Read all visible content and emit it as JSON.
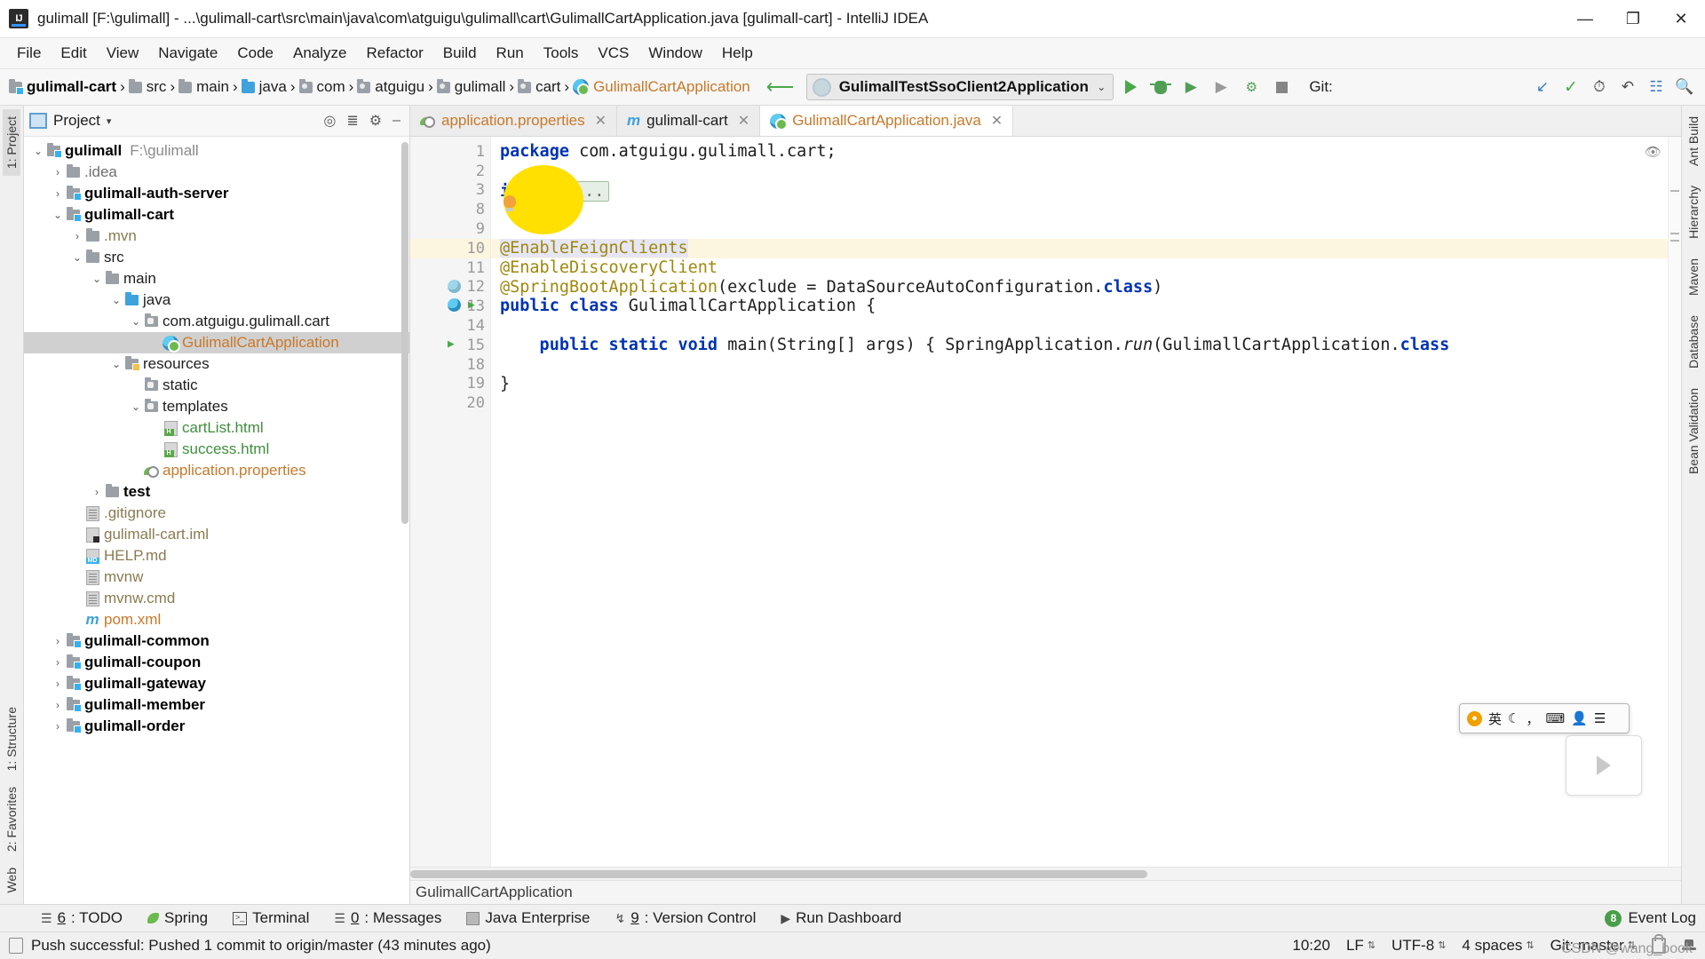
{
  "window": {
    "title": "gulimall [F:\\gulimall] - ...\\gulimall-cart\\src\\main\\java\\com\\atguigu\\gulimall\\cart\\GulimallCartApplication.java [gulimall-cart] - IntelliJ IDEA",
    "minimize": "—",
    "maximize": "❐",
    "close": "✕",
    "logo_text": "IJ"
  },
  "menubar": {
    "items": [
      "File",
      "Edit",
      "View",
      "Navigate",
      "Code",
      "Analyze",
      "Refactor",
      "Build",
      "Run",
      "Tools",
      "VCS",
      "Window",
      "Help"
    ]
  },
  "navbar": {
    "breadcrumbs": [
      {
        "label": "gulimall-cart",
        "kind": "module"
      },
      {
        "label": "src",
        "kind": "folder"
      },
      {
        "label": "main",
        "kind": "folder"
      },
      {
        "label": "java",
        "kind": "source"
      },
      {
        "label": "com",
        "kind": "package"
      },
      {
        "label": "atguigu",
        "kind": "package"
      },
      {
        "label": "gulimall",
        "kind": "package"
      },
      {
        "label": "cart",
        "kind": "package"
      },
      {
        "label": "GulimallCartApplication",
        "kind": "class"
      }
    ],
    "separator": "›",
    "run_config": {
      "name": "GulimallTestSsoClient2Application",
      "caret": "⌄"
    },
    "buttons": [
      "run-button",
      "debug-button",
      "run-with-coverage-button",
      "profile-button",
      "attach-button",
      "stop-button"
    ],
    "git_label": "Git:",
    "right_icons": [
      "update-project-icon",
      "check-icon",
      "history-icon",
      "rollback-icon",
      "open-settings-icon",
      "search-icon"
    ]
  },
  "left_rail": {
    "top": [
      "1: Project"
    ],
    "bottom": [
      "1: Structure",
      "2: Favorites",
      "Web"
    ]
  },
  "right_rail": {
    "items": [
      "Ant Build",
      "Hierarchy",
      "Maven",
      "Database",
      "Bean Validation"
    ]
  },
  "project_panel": {
    "title": "Project",
    "caret": "▾",
    "header_icons": [
      "locate-icon",
      "collapse-all-icon",
      "settings-icon",
      "hide-icon"
    ],
    "tree": [
      {
        "depth": 0,
        "arrow": "⌄",
        "icon": "module-folder",
        "label": "gulimall",
        "style": "bold",
        "suffix": "F:\\gulimall"
      },
      {
        "depth": 1,
        "arrow": "›",
        "icon": "folder",
        "label": ".idea",
        "style": "gray"
      },
      {
        "depth": 1,
        "arrow": "›",
        "icon": "module-folder",
        "label": "gulimall-auth-server",
        "style": "bold"
      },
      {
        "depth": 1,
        "arrow": "⌄",
        "icon": "module-folder",
        "label": "gulimall-cart",
        "style": "bold"
      },
      {
        "depth": 2,
        "arrow": "›",
        "icon": "folder",
        "label": ".mvn",
        "style": "tan"
      },
      {
        "depth": 2,
        "arrow": "⌄",
        "icon": "folder",
        "label": "src",
        "style": "black"
      },
      {
        "depth": 3,
        "arrow": "⌄",
        "icon": "folder",
        "label": "main",
        "style": "black"
      },
      {
        "depth": 4,
        "arrow": "⌄",
        "icon": "source-folder",
        "label": "java",
        "style": "black"
      },
      {
        "depth": 5,
        "arrow": "⌄",
        "icon": "package",
        "label": "com.atguigu.gulimall.cart",
        "style": "black"
      },
      {
        "depth": 6,
        "arrow": "",
        "icon": "spring-class",
        "label": "GulimallCartApplication",
        "style": "orange",
        "selected": true
      },
      {
        "depth": 4,
        "arrow": "⌄",
        "icon": "resource-folder",
        "label": "resources",
        "style": "black"
      },
      {
        "depth": 5,
        "arrow": "",
        "icon": "package",
        "label": "static",
        "style": "black"
      },
      {
        "depth": 5,
        "arrow": "⌄",
        "icon": "package",
        "label": "templates",
        "style": "black"
      },
      {
        "depth": 6,
        "arrow": "",
        "icon": "html-file",
        "label": "cartList.html",
        "style": "green"
      },
      {
        "depth": 6,
        "arrow": "",
        "icon": "html-file",
        "label": "success.html",
        "style": "green"
      },
      {
        "depth": 5,
        "arrow": "",
        "icon": "spring-properties",
        "label": "application.properties",
        "style": "orange"
      },
      {
        "depth": 3,
        "arrow": "›",
        "icon": "folder",
        "label": "test",
        "style": "bold"
      },
      {
        "depth": 2,
        "arrow": "",
        "icon": "text-file",
        "label": ".gitignore",
        "style": "tan"
      },
      {
        "depth": 2,
        "arrow": "",
        "icon": "iml-file",
        "label": "gulimall-cart.iml",
        "style": "tan"
      },
      {
        "depth": 2,
        "arrow": "",
        "icon": "md-file",
        "label": "HELP.md",
        "style": "tan"
      },
      {
        "depth": 2,
        "arrow": "",
        "icon": "text-file",
        "label": "mvnw",
        "style": "tan"
      },
      {
        "depth": 2,
        "arrow": "",
        "icon": "text-file",
        "label": "mvnw.cmd",
        "style": "tan"
      },
      {
        "depth": 2,
        "arrow": "",
        "icon": "maven-file",
        "label": "pom.xml",
        "style": "orange"
      },
      {
        "depth": 1,
        "arrow": "›",
        "icon": "module-folder",
        "label": "gulimall-common",
        "style": "bold"
      },
      {
        "depth": 1,
        "arrow": "›",
        "icon": "module-folder",
        "label": "gulimall-coupon",
        "style": "bold"
      },
      {
        "depth": 1,
        "arrow": "›",
        "icon": "module-folder",
        "label": "gulimall-gateway",
        "style": "bold"
      },
      {
        "depth": 1,
        "arrow": "›",
        "icon": "module-folder",
        "label": "gulimall-member",
        "style": "bold"
      },
      {
        "depth": 1,
        "arrow": "›",
        "icon": "module-folder",
        "label": "gulimall-order",
        "style": "bold"
      }
    ]
  },
  "editor": {
    "tabs": [
      {
        "label": "application.properties",
        "icon": "spring-properties-icon",
        "active": false,
        "close": "✕"
      },
      {
        "label": "gulimall-cart",
        "icon": "maven-icon",
        "active": false,
        "close": "✕"
      },
      {
        "label": "GulimallCartApplication.java",
        "icon": "spring-class-icon",
        "active": true,
        "close": "✕"
      }
    ],
    "line_numbers": [
      "1",
      "2",
      "3",
      "8",
      "9",
      "10",
      "11",
      "12",
      "13",
      "14",
      "15",
      "18",
      "19",
      "20"
    ],
    "highlighted_line": "10",
    "lines": [
      {
        "num": "1",
        "segments": [
          {
            "t": "package",
            "c": "kw"
          },
          {
            "t": " com.atguigu.gulimall.cart;",
            "c": "txt"
          }
        ]
      },
      {
        "num": "2",
        "segments": []
      },
      {
        "num": "3",
        "segments": [
          {
            "t": "import",
            "c": "kw"
          },
          {
            "t": " ",
            "c": "txt"
          },
          {
            "t": "...",
            "c": "dots"
          }
        ],
        "fold": "+"
      },
      {
        "num": "8",
        "segments": []
      },
      {
        "num": "9",
        "segments": []
      },
      {
        "num": "10",
        "segments": [
          {
            "t": "@EnableFeignClients",
            "c": "anno-hl"
          }
        ],
        "fold": "-",
        "highlight": true
      },
      {
        "num": "11",
        "segments": [
          {
            "t": "@EnableDiscoveryClient",
            "c": "anno"
          }
        ]
      },
      {
        "num": "12",
        "segments": [
          {
            "t": "@SpringBootApplication",
            "c": "anno"
          },
          {
            "t": "(exclude = DataSourceAutoConfiguration.",
            "c": "txt"
          },
          {
            "t": "class",
            "c": "kw"
          },
          {
            "t": ")",
            "c": "txt"
          }
        ],
        "fold": "-"
      },
      {
        "num": "13",
        "segments": [
          {
            "t": "public class ",
            "c": "kw"
          },
          {
            "t": "GulimallCartApplication {",
            "c": "txt"
          }
        ]
      },
      {
        "num": "14",
        "segments": []
      },
      {
        "num": "15",
        "segments": [
          {
            "t": "    public static void ",
            "c": "kw"
          },
          {
            "t": "main(String[] args) { SpringApplication.",
            "c": "txt"
          },
          {
            "t": "run",
            "c": "ital"
          },
          {
            "t": "(GulimallCartApplication.",
            "c": "txt"
          },
          {
            "t": "class",
            "c": "kw"
          }
        ],
        "fold": "-"
      },
      {
        "num": "18",
        "segments": []
      },
      {
        "num": "19",
        "segments": [
          {
            "t": "}",
            "c": "txt"
          }
        ]
      },
      {
        "num": "20",
        "segments": []
      }
    ],
    "status_breadcrumb": "GulimallCartApplication"
  },
  "ime": {
    "lang": "英",
    "icons": [
      "moon-icon",
      "comma-icon",
      "keyboard-icon",
      "user-icon",
      "menu-icon"
    ]
  },
  "bottom_toolwindows": [
    {
      "num": "6",
      "label": ": TODO",
      "icon": "todo-icon"
    },
    {
      "num": "",
      "label": "Spring",
      "icon": "spring-leaf-icon"
    },
    {
      "num": "",
      "label": "Terminal",
      "icon": "terminal-icon"
    },
    {
      "num": "0",
      "label": ": Messages",
      "icon": "messages-icon"
    },
    {
      "num": "",
      "label": "Java Enterprise",
      "icon": "java-ee-icon"
    },
    {
      "num": "9",
      "label": ": Version Control",
      "icon": "vcs-icon"
    },
    {
      "num": "",
      "label": "Run Dashboard",
      "icon": "run-dashboard-icon"
    }
  ],
  "event_log": {
    "count": "8",
    "label": "Event Log"
  },
  "statusbar": {
    "message": "Push successful: Pushed 1 commit to origin/master (43 minutes ago)",
    "caret_position": "10:20",
    "line_separator": "LF",
    "encoding": "UTF-8",
    "indent": "4 spaces",
    "branch": "Git: master",
    "updown": "⇅",
    "icons": [
      "lock-icon",
      "hector-icon"
    ]
  },
  "watermark": "CSDN @wang_book",
  "colors": {
    "accent_orange": "#c8792a",
    "annotation_yellow": "#9e880d",
    "keyword_blue": "#0033b3",
    "green": "#4aa84a",
    "selection_gray": "#d0d0d0",
    "highlight_line": "#fcf6e0",
    "blob_yellow": "#ffe000"
  }
}
